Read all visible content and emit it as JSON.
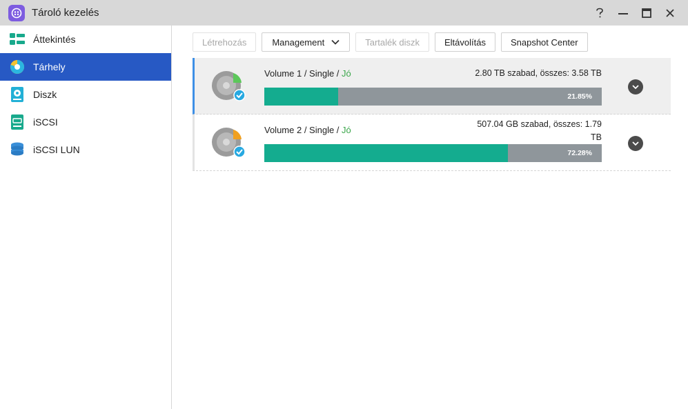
{
  "window": {
    "title": "Tároló kezelés",
    "controls": {
      "help": "?",
      "minimize": "—",
      "maximize": "☐",
      "close": "✕"
    }
  },
  "sidebar": {
    "items": [
      {
        "label": "Áttekintés",
        "icon": "overview-icon",
        "active": false
      },
      {
        "label": "Tárhely",
        "icon": "storage-icon",
        "active": true
      },
      {
        "label": "Diszk",
        "icon": "disk-icon",
        "active": false
      },
      {
        "label": "iSCSI",
        "icon": "iscsi-icon",
        "active": false
      },
      {
        "label": "iSCSI LUN",
        "icon": "iscsi-lun-icon",
        "active": false
      }
    ]
  },
  "toolbar": {
    "create": "Létrehozás",
    "management": "Management",
    "spare_disk": "Tartalék diszk",
    "remove": "Eltávolítás",
    "snapshot_center": "Snapshot Center"
  },
  "volumes": [
    {
      "name": "Volume 1",
      "type": "Single",
      "status": "Jó",
      "capacity_line1": "2.80 TB szabad, összes: 3.58 TB",
      "capacity_line2": "",
      "used_percent": 21.85,
      "used_label": "21.85%",
      "pie_color": "#5cc85a",
      "selected": true
    },
    {
      "name": "Volume 2",
      "type": "Single",
      "status": "Jó",
      "capacity_line1": "507.04 GB szabad, összes: 1.79",
      "capacity_line2": "TB",
      "used_percent": 72.28,
      "used_label": "72.28%",
      "pie_color": "#f0a020",
      "selected": false
    }
  ],
  "colors": {
    "accent": "#2759c4",
    "bar_used": "#14ac8f",
    "bar_free": "#8f969b",
    "status_ok": "#3aa64a",
    "selection_border": "#3d8fe6"
  }
}
